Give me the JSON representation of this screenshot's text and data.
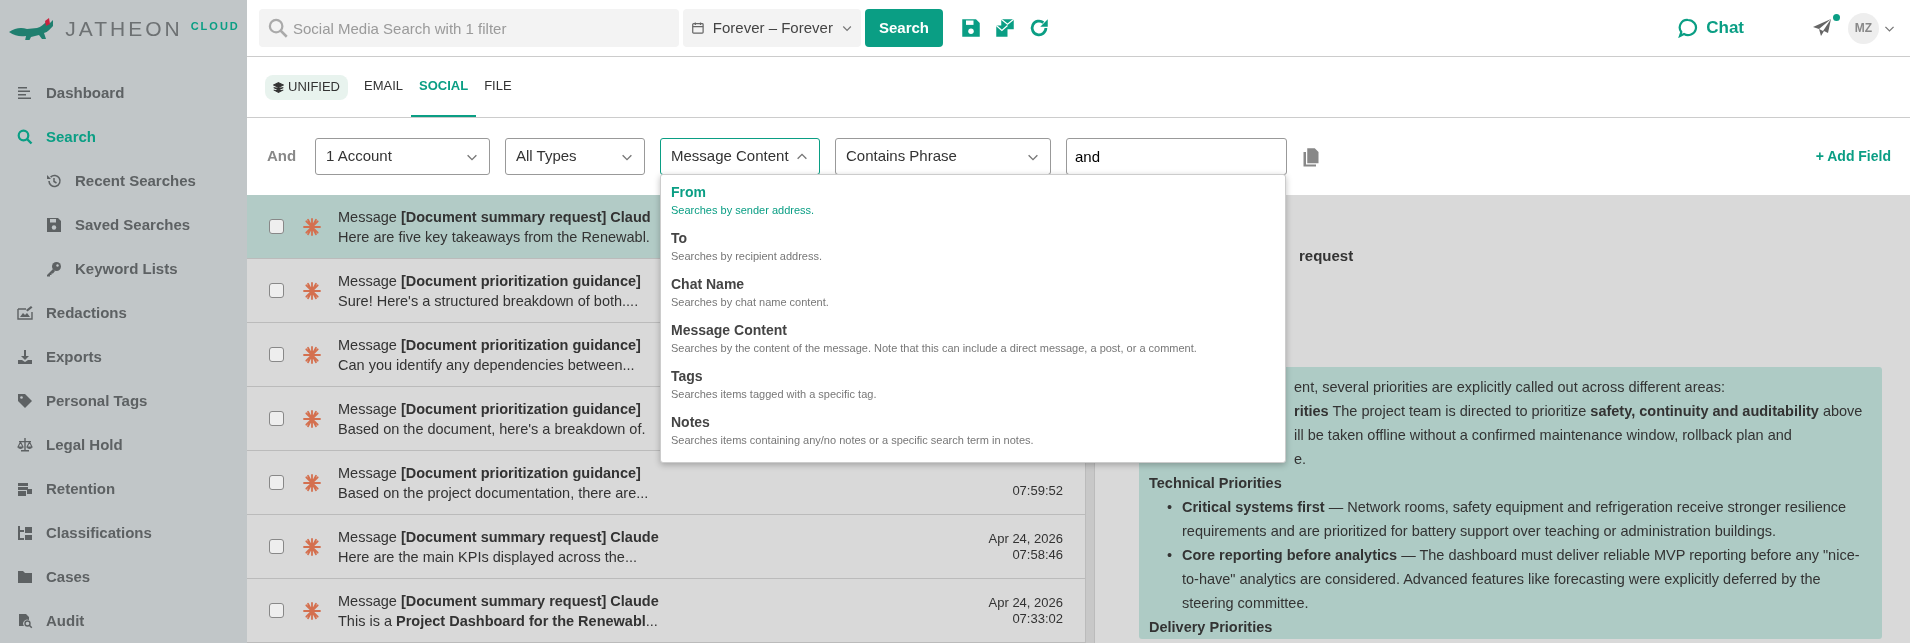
{
  "logo": {
    "wordmark": "JATHEON",
    "suffix": "CLOUD"
  },
  "sidebar": {
    "items": [
      {
        "label": "Dashboard",
        "selected": false
      },
      {
        "label": "Search",
        "selected": true,
        "children": [
          {
            "label": "Recent Searches",
            "selected": false
          },
          {
            "label": "Saved Searches",
            "selected": false
          },
          {
            "label": "Keyword Lists",
            "selected": false
          }
        ]
      },
      {
        "label": "Redactions",
        "selected": false
      },
      {
        "label": "Exports",
        "selected": false
      },
      {
        "label": "Personal Tags",
        "selected": false
      },
      {
        "label": "Legal Hold",
        "selected": false
      },
      {
        "label": "Retention",
        "selected": false
      },
      {
        "label": "Classifications",
        "selected": false
      },
      {
        "label": "Cases",
        "selected": false
      },
      {
        "label": "Audit",
        "selected": false
      }
    ]
  },
  "top_bar": {
    "search": {
      "placeholder": "Social Media Search with 1 filter"
    },
    "date_range": "Forever – Forever",
    "search_button": "Search",
    "chat": "Chat",
    "notification": true,
    "avatar": "MZ"
  },
  "tabs": [
    {
      "label": "UNIFIED",
      "kind": "pill",
      "selected": false
    },
    {
      "label": "EMAIL",
      "kind": "plain",
      "selected": false
    },
    {
      "label": "SOCIAL",
      "kind": "plain",
      "selected": true
    },
    {
      "label": "FILE",
      "kind": "plain",
      "selected": false
    }
  ],
  "filter": {
    "operator": "And",
    "fields": [
      {
        "kind": "select",
        "value": "1 Account",
        "expanded": false
      },
      {
        "kind": "select",
        "value": "All Types",
        "expanded": false
      },
      {
        "kind": "select",
        "value": "Message Content",
        "expanded": true
      },
      {
        "kind": "select",
        "value": "Contains Phrase",
        "expanded": false
      },
      {
        "kind": "input",
        "value": "and"
      }
    ],
    "add_field": "+ Add Field"
  },
  "dropdown": {
    "options": [
      {
        "title": "From",
        "description": "Searches by sender address.",
        "selected": true
      },
      {
        "title": "To",
        "description": "Searches by recipient address.",
        "selected": false
      },
      {
        "title": "Chat Name",
        "description": "Searches by chat name content.",
        "selected": false
      },
      {
        "title": "Message Content",
        "description": "Searches by the content of the message. Note that this can include a direct message, a post, or a comment.",
        "selected": false
      },
      {
        "title": "Tags",
        "description": "Searches items tagged with a specific tag.",
        "selected": false
      },
      {
        "title": "Notes",
        "description": "Searches items containing any/no notes or a specific search term in notes.",
        "selected": false
      }
    ]
  },
  "results": {
    "rows": [
      {
        "type": "Message",
        "subject": "[Document summary request] Claud",
        "preview": "Here are five key takeaways from the Renewabl.",
        "selected": true,
        "checked": false
      },
      {
        "type": "Message",
        "subject": "[Document prioritization guidance]",
        "preview": "Sure! Here's a structured breakdown of both....",
        "selected": false,
        "checked": false
      },
      {
        "type": "Message",
        "subject": "[Document prioritization guidance]",
        "preview": "Can you identify any dependencies between...",
        "selected": false,
        "checked": false
      },
      {
        "type": "Message",
        "subject": "[Document prioritization guidance]",
        "preview": "Based on the document, here's a breakdown of.",
        "selected": false,
        "checked": false
      },
      {
        "type": "Message",
        "subject": "[Document prioritization guidance]",
        "preview": "Based on the project documentation, there are...",
        "time": "07:59:52",
        "selected": false,
        "checked": false
      },
      {
        "type": "Message",
        "subject": "[Document summary request] Claude",
        "preview": "Here are the main KPIs displayed across the...",
        "date": "Apr 24, 2026",
        "time": "07:58:46",
        "selected": false,
        "checked": false
      },
      {
        "type": "Message",
        "subject": "[Document summary request] Claude",
        "preview": "This is a **Project Dashboard for the Renewabl**...",
        "date": "Apr 24, 2026",
        "time": "07:33:02",
        "selected": false,
        "checked": false
      }
    ]
  },
  "detail": {
    "heading": "request",
    "body": [
      {
        "kind": "fragment",
        "text": "ent, several priorities are explicitly called out across different areas:"
      },
      {
        "kind": "fragment",
        "text": "**rities** The project team is directed to prioritize **safety, continuity and auditability** above"
      },
      {
        "kind": "fragment",
        "text": "ill be taken offline without a confirmed maintenance window, rollback plan and"
      },
      {
        "kind": "fragment",
        "text": "e."
      },
      {
        "kind": "heading",
        "text": "Technical Priorities"
      },
      {
        "kind": "bullet",
        "marker": "•",
        "text": "**Critical systems first** — Network rooms, safety equipment and refrigeration receive stronger resilience requirements and are prioritized for battery support over teaching or administration buildings."
      },
      {
        "kind": "bullet",
        "marker": "•",
        "text": "**Core reporting before analytics** — The dashboard must deliver reliable MVP reporting before any \"nice-to-have\" analytics are considered. Advanced features like forecasting were explicitly deferred by the steering committee."
      },
      {
        "kind": "heading",
        "text": "Delivery Priorities"
      }
    ]
  }
}
